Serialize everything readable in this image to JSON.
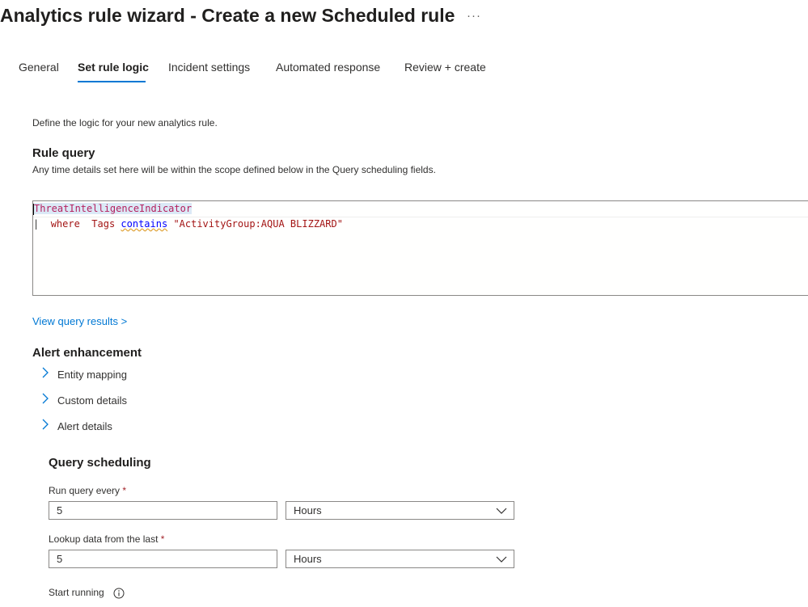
{
  "page": {
    "title": "Analytics rule wizard - Create a new Scheduled rule",
    "more_label": "···"
  },
  "tabs": [
    {
      "label": "General"
    },
    {
      "label": "Set rule logic"
    },
    {
      "label": "Incident settings"
    },
    {
      "label": "Automated response"
    },
    {
      "label": "Review + create"
    }
  ],
  "intro": "Define the logic for your new analytics rule.",
  "rule_query": {
    "heading": "Rule query",
    "description": "Any time details set here will be within the scope defined below in the Query scheduling fields.",
    "line1_table": "ThreatIntelligenceIndicator",
    "line2_pipe": "| ",
    "line2_where": "where",
    "line2_tags": "Tags",
    "line2_contains": "contains",
    "line2_string": "\"ActivityGroup:AQUA BLIZZARD\""
  },
  "view_results_link": "View query results >",
  "alert_enhancement": {
    "heading": "Alert enhancement",
    "items": [
      {
        "label": "Entity mapping"
      },
      {
        "label": "Custom details"
      },
      {
        "label": "Alert details"
      }
    ]
  },
  "query_scheduling": {
    "heading": "Query scheduling",
    "run_every": {
      "label": "Run query every",
      "required": "*",
      "value": "5",
      "unit": "Hours"
    },
    "lookup": {
      "label": "Lookup data from the last",
      "required": "*",
      "value": "5",
      "unit": "Hours"
    },
    "start_running": {
      "label": "Start running"
    }
  },
  "colors": {
    "accent": "#0078d4",
    "required": "#a4262c"
  },
  "icons": {
    "more": "more-icon",
    "chevron_right": "chevron-right-icon",
    "chevron_down": "chevron-down-icon",
    "info": "info-icon"
  }
}
